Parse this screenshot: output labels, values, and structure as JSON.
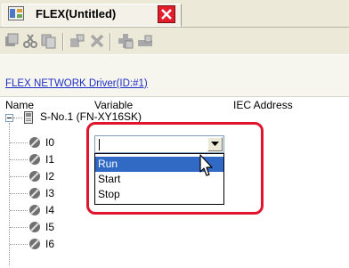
{
  "window": {
    "tab_title": "FLEX(Untitled)",
    "tab_icon": "flex-editor-icon",
    "close_icon": "close-icon"
  },
  "toolbar": {
    "buttons": [
      {
        "icon": "add-item-icon"
      },
      {
        "icon": "cut-icon"
      },
      {
        "icon": "copy-icon"
      },
      {
        "icon": "paste-icon"
      },
      {
        "icon": "delete-icon"
      },
      {
        "icon": "add-module-icon"
      },
      {
        "icon": "remove-module-icon"
      }
    ]
  },
  "driver_link": "FLEX NETWORK Driver(ID:#1)",
  "columns": {
    "name": "Name",
    "variable": "Variable",
    "iec_address": "IEC Address"
  },
  "tree": {
    "device_label": "S-No.1 (FN-XY16SK)",
    "items": [
      "I0",
      "I1",
      "I2",
      "I3",
      "I4",
      "I5",
      "I6"
    ]
  },
  "variable_dropdown": {
    "value": "",
    "options": [
      "Run",
      "Start",
      "Stop"
    ],
    "highlighted": "Run"
  },
  "colors": {
    "selection": "#316ac5",
    "highlight_frame": "#e0142c",
    "close_button": "#e21d2c",
    "link": "#1d2fc4"
  }
}
